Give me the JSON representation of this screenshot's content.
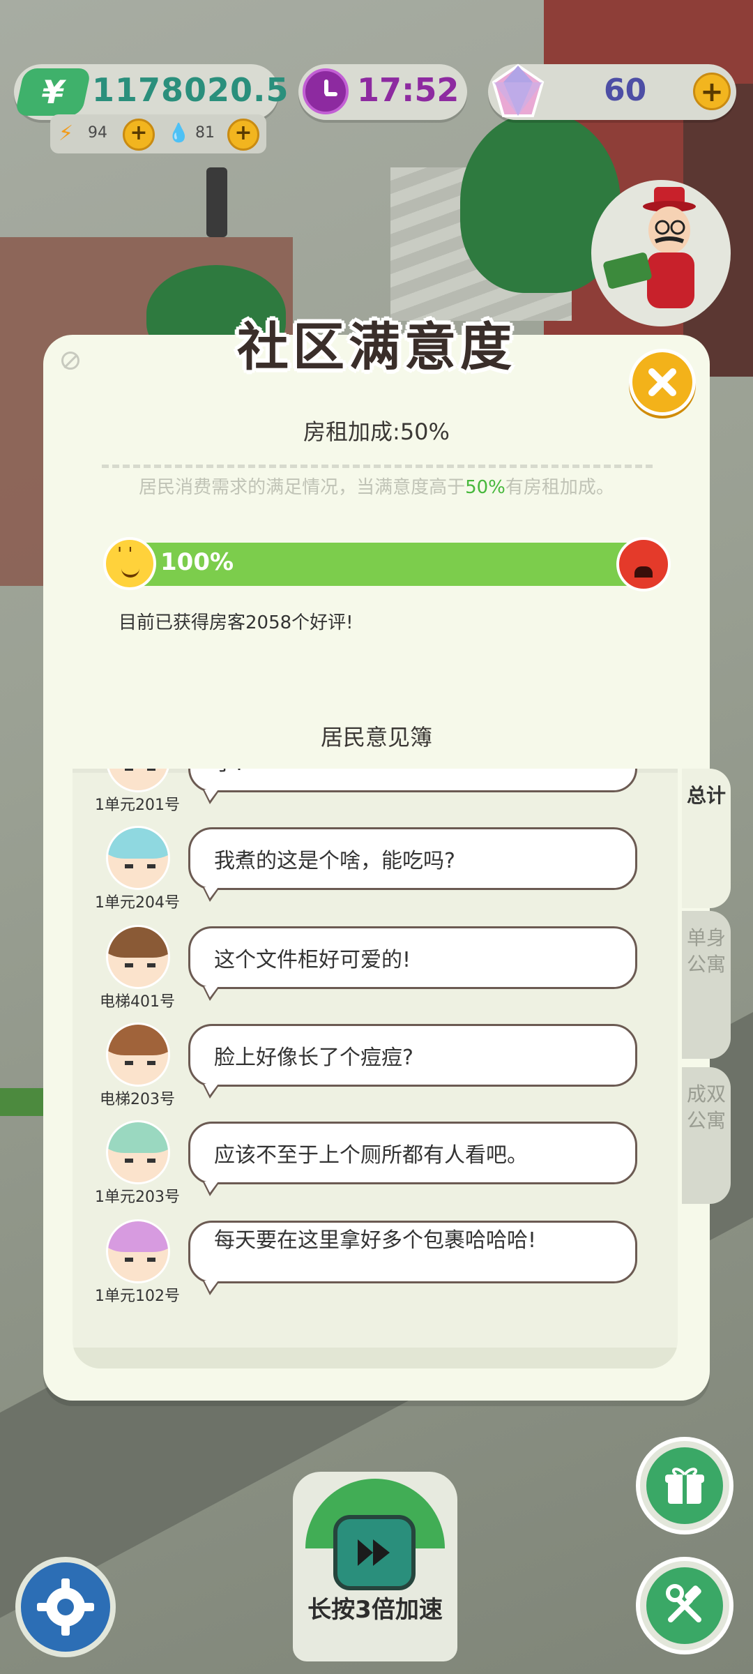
{
  "hud": {
    "money_symbol": "¥",
    "money": "1178020.5",
    "energy": "94",
    "water": "81",
    "time": "17:52",
    "gems": "60",
    "plus": "+"
  },
  "modal": {
    "title": "社区满意度",
    "rent_bonus": "房租加成:50%",
    "desc_pre": "居民消费需求的满足情况，当满意度高于",
    "desc_hl": "50%",
    "desc_post": "有房租加成。",
    "satisfaction": 1.0,
    "satisfaction_label": "100%",
    "good_reviews": "目前已获得房客2058个好评!",
    "book_title": "居民意见簿",
    "close_label": "✕"
  },
  "comments": [
    {
      "room": "1单元201号",
      "text": "了!",
      "hair": "#f0a0b0"
    },
    {
      "room": "1单元204号",
      "text": "我煮的这是个啥，能吃吗?",
      "hair": "#8fd8e0"
    },
    {
      "room": "电梯401号",
      "text": "这个文件柜好可爱的!",
      "hair": "#8a5a36"
    },
    {
      "room": "电梯203号",
      "text": "脸上好像长了个痘痘?",
      "hair": "#a0633a"
    },
    {
      "room": "1单元203号",
      "text": "应该不至于上个厕所都有人看吧。",
      "hair": "#9ad8c0"
    },
    {
      "room": "1单元102号",
      "text": "每天要在这里拿好多个包裹哈哈哈!",
      "hair": "#d79be0"
    }
  ],
  "tabs": {
    "total": "总计",
    "single": "单身公寓",
    "double": "成双公寓"
  },
  "speed_button": "长按3倍加速",
  "colors": {
    "accent_green": "#4fae3a",
    "bar_green": "#7ccd4c",
    "close_yellow": "#f3b21a",
    "money_text": "#2a8f7c",
    "clock_purple": "#8d2aa0",
    "gem_text": "#4d4ea5"
  }
}
